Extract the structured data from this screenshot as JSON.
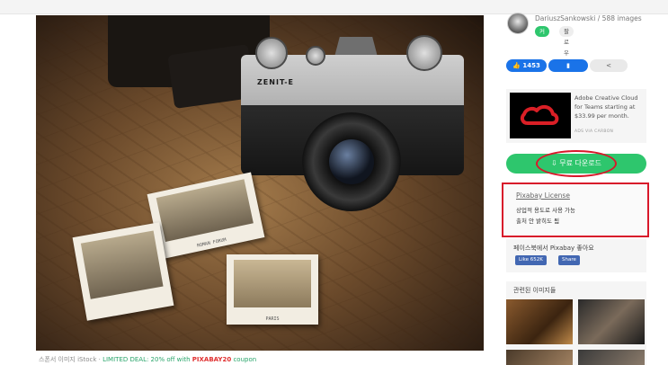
{
  "photo": {
    "camera_brand": "ZENIT-E",
    "polaroid_captions": [
      "ROMAN FORUM",
      "PARIS"
    ],
    "polaroid_stamp": "PARIS"
  },
  "caption": {
    "prefix": "스폰서 이미지 iStock · ",
    "deal": "LIMITED DEAL: 20% off with ",
    "code": "PIXABAY20",
    "suffix": " coupon"
  },
  "author": {
    "name": "DariuszSankowski / 588 images",
    "follow_label": "커피",
    "follow2_label": "팔로우"
  },
  "actions": {
    "like_count": "1453",
    "like_icon": "thumbs-up-icon",
    "save_icon": "bookmark-icon",
    "share_icon": "share-icon"
  },
  "ad": {
    "text": "Adobe Creative Cloud for Teams starting at $33.99 per month.",
    "via": "ADS VIA CARBON",
    "logo_color": "#da1f26"
  },
  "download": {
    "label": "무료 다운로드",
    "icon": "download-icon"
  },
  "license": {
    "title": "Pixabay License",
    "line1": "상업적 용도로 사용 가능",
    "line2": "출처 안 밝히도 됨"
  },
  "facebook": {
    "title": "페이스북에서 Pixabay 좋아요",
    "like_label": "Like 652K",
    "share_label": "Share"
  },
  "related": {
    "title": "관련된 이미지들"
  },
  "colors": {
    "accent_green": "#2ec66d",
    "accent_blue": "#1a73e8",
    "highlight_red": "#d8182a"
  }
}
